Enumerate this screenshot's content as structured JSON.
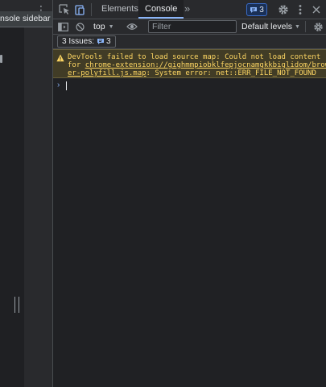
{
  "left_panel": {
    "tooltip_text": "nsole sidebar",
    "more_icon": "vertical-ellipsis-icon"
  },
  "tabbar": {
    "inspect_icon": "inspect-element-icon",
    "device_icon": "device-toolbar-icon",
    "tabs": [
      {
        "label": "Elements"
      },
      {
        "label": "Console"
      }
    ],
    "more_tabs_label": "»",
    "issues_count": "3",
    "accent_color": "#8ab4f8"
  },
  "console_toolbar": {
    "context": "top",
    "filter_placeholder": "Filter",
    "levels": "Default levels"
  },
  "issues_bar": {
    "label": "3 Issues:",
    "count": "3"
  },
  "messages": {
    "warning": {
      "prefix": "DevTools failed to load source map: Could not load content",
      "for_word": "for ",
      "url_part1": "chrome-extension://gighmmpiobklfepjocnamgkkbiglidom/brows",
      "url_part2": "er-polyfill.js.map",
      "suffix": ": System error: net::ERR_FILE_NOT_FOUND",
      "color": "#fdd663",
      "background": "#413c26"
    },
    "prompt_symbol": "›"
  }
}
